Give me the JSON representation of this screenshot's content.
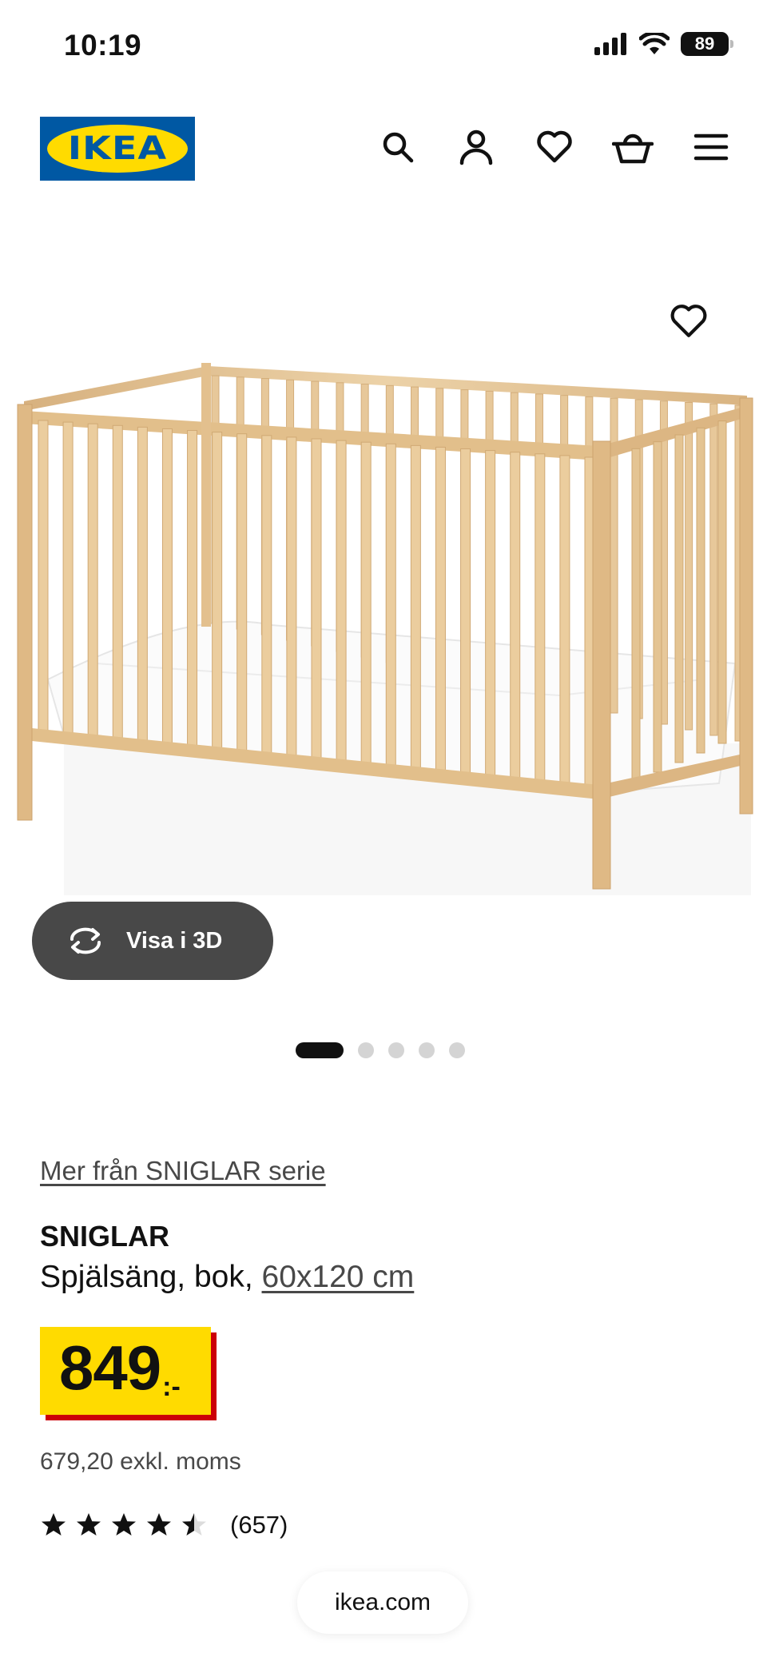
{
  "status_bar": {
    "time": "10:19",
    "battery": "89"
  },
  "header": {
    "logo_text": "IKEA",
    "icons": [
      "search-icon",
      "account-icon",
      "favourites-icon",
      "cart-icon",
      "menu-icon"
    ]
  },
  "gallery": {
    "view_3d_label": "Visa i 3D",
    "slide_count": 5,
    "active_slide": 1
  },
  "product": {
    "series_link": "Mer från SNIGLAR serie",
    "name": "SNIGLAR",
    "description": "Spjälsäng, bok, ",
    "size_link": "60x120 cm",
    "price_integer": "849",
    "price_suffix": ":-",
    "price_excl_vat": "679,20 exkl. moms",
    "rating_value": 4.5,
    "rating_max": 5,
    "review_count": "(657)"
  },
  "browser": {
    "url": "ikea.com"
  },
  "colors": {
    "ikea_blue": "#0058a3",
    "ikea_yellow": "#ffdb00",
    "price_shadow": "#cc0008",
    "wood": "#e4c497"
  }
}
